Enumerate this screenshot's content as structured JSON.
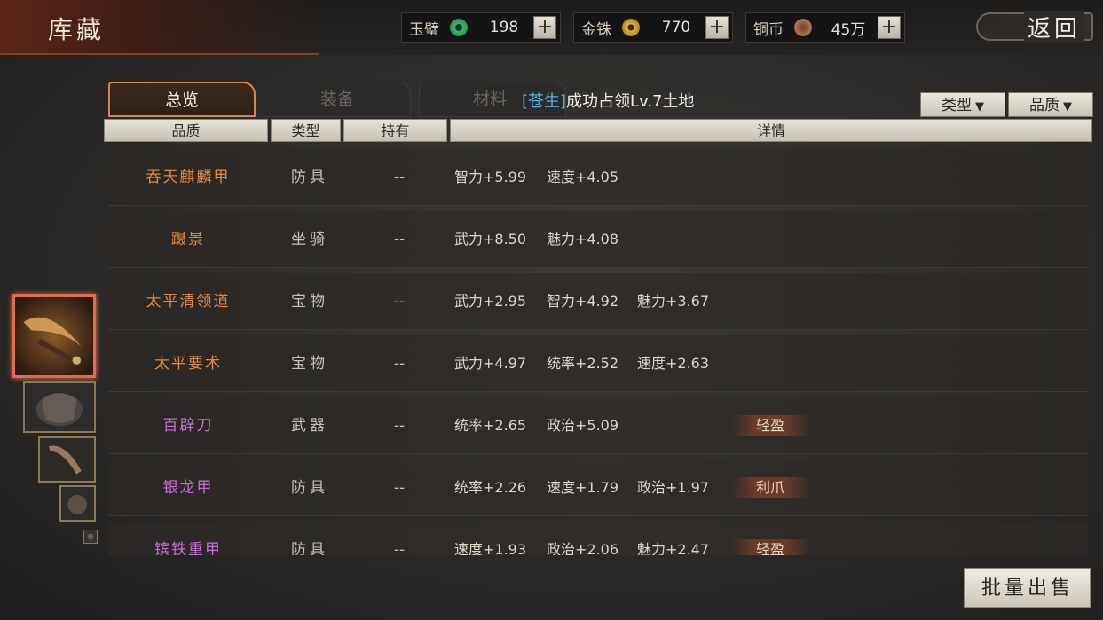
{
  "header": {
    "title": "库藏",
    "back_label": "返回",
    "currencies": [
      {
        "label": "玉璧",
        "value": "198",
        "icon": "jade-coin-icon",
        "color": "#3bb86a"
      },
      {
        "label": "金铢",
        "value": "770",
        "icon": "gold-coin-icon",
        "color": "#e2b33c"
      },
      {
        "label": "铜币",
        "value": "45万",
        "icon": "copper-coin-icon",
        "color": "#b07350"
      }
    ],
    "plus_symbol": "+"
  },
  "tabs": [
    {
      "label": "总览",
      "active": true
    },
    {
      "label": "装备",
      "active": false
    },
    {
      "label": "材料",
      "active": false
    }
  ],
  "notice": {
    "tag": "[苍生]",
    "text": "成功占领Lv.7土地"
  },
  "filters": {
    "type_label": "类型",
    "quality_label": "品质",
    "arrow": "▼"
  },
  "table": {
    "columns": [
      "品质",
      "类型",
      "持有",
      "详情"
    ],
    "rows": [
      {
        "name": "吞天麒麟甲",
        "rarity": "orange",
        "type": "防具",
        "held": "--",
        "stats": [
          "智力+5.99",
          "速度+4.05",
          ""
        ],
        "trait": ""
      },
      {
        "name": "蹑景",
        "rarity": "orange",
        "type": "坐骑",
        "held": "--",
        "stats": [
          "武力+8.50",
          "魅力+4.08",
          ""
        ],
        "trait": ""
      },
      {
        "name": "太平清领道",
        "rarity": "orange",
        "type": "宝物",
        "held": "--",
        "stats": [
          "武力+2.95",
          "智力+4.92",
          "魅力+3.67"
        ],
        "trait": ""
      },
      {
        "name": "太平要术",
        "rarity": "orange",
        "type": "宝物",
        "held": "--",
        "stats": [
          "武力+4.97",
          "统率+2.52",
          "速度+2.63"
        ],
        "trait": ""
      },
      {
        "name": "百辟刀",
        "rarity": "purple",
        "type": "武器",
        "held": "--",
        "stats": [
          "统率+2.65",
          "政治+5.09",
          ""
        ],
        "trait": "轻盈"
      },
      {
        "name": "银龙甲",
        "rarity": "purple",
        "type": "防具",
        "held": "--",
        "stats": [
          "统率+2.26",
          "速度+1.79",
          "政治+1.97"
        ],
        "trait": "利爪"
      },
      {
        "name": "镔铁重甲",
        "rarity": "purple",
        "type": "防具",
        "held": "--",
        "stats": [
          "速度+1.93",
          "政治+2.06",
          "魅力+2.47"
        ],
        "trait": "轻盈"
      }
    ]
  },
  "sell_button": "批量出售",
  "colors": {
    "orange": "#e48a3e",
    "purple": "#c46fd7",
    "accent": "#d3874a"
  }
}
